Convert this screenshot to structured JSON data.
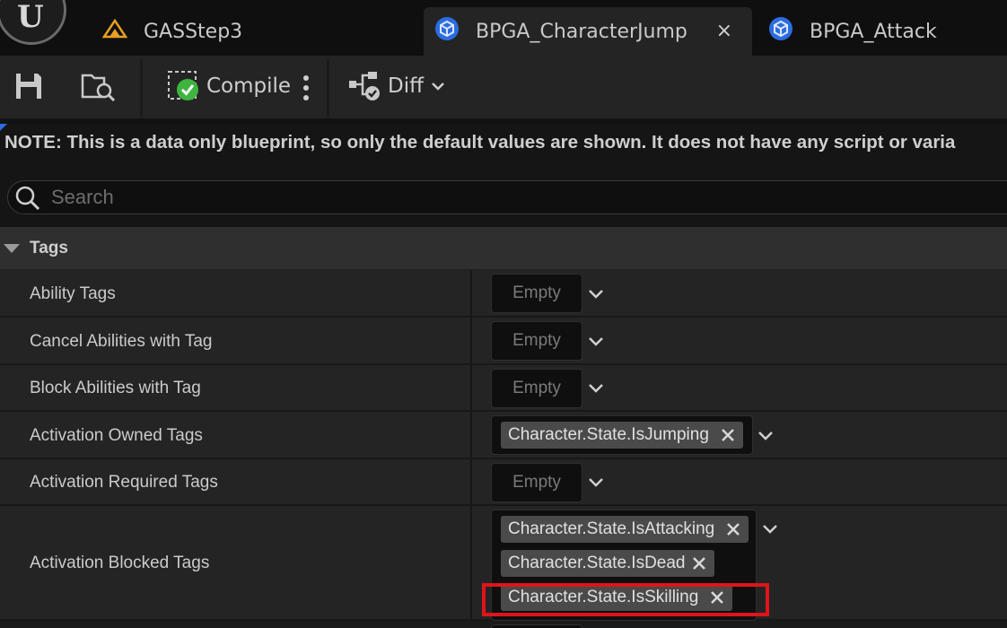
{
  "tabs": [
    {
      "label": "GASStep3",
      "icon": "level-icon",
      "active": false
    },
    {
      "label": "BPGA_CharacterJump",
      "icon": "blueprint-icon",
      "active": true,
      "close": "×"
    },
    {
      "label": "BPGA_Attack",
      "icon": "blueprint-icon",
      "active": false
    }
  ],
  "toolbar": {
    "compile_label": "Compile",
    "diff_label": "Diff"
  },
  "note": "NOTE: This is a data only blueprint, so only the default values are shown.  It does not have any script or varia",
  "search": {
    "placeholder": "Search",
    "value": ""
  },
  "category": {
    "label": "Tags"
  },
  "properties": [
    {
      "label": "Ability Tags",
      "value": "Empty"
    },
    {
      "label": "Cancel Abilities with Tag",
      "value": "Empty"
    },
    {
      "label": "Block Abilities with Tag",
      "value": "Empty"
    },
    {
      "label": "Activation Owned Tags",
      "tags": [
        "Character.State.IsJumping"
      ]
    },
    {
      "label": "Activation Required Tags",
      "value": "Empty"
    },
    {
      "label": "Activation Blocked Tags",
      "tags": [
        "Character.State.IsAttacking",
        "Character.State.IsDead",
        "Character.State.IsSkilling"
      ]
    }
  ],
  "colors": {
    "highlight": "#e0141a",
    "blueprint_accent": "#2b6de1",
    "compile_ok": "#3fb43f"
  }
}
